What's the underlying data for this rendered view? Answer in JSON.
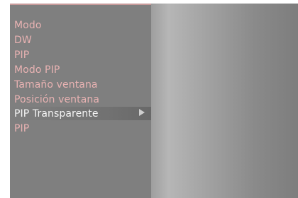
{
  "menu": {
    "items": [
      {
        "label": "Modo"
      },
      {
        "label": "DW"
      },
      {
        "label": "PIP"
      },
      {
        "label": "Modo PIP"
      },
      {
        "label": "Tamaño ventana"
      },
      {
        "label": "Posición ventana"
      },
      {
        "label": "PIP Transparente"
      },
      {
        "label": "PIP"
      }
    ],
    "selected_index": 6
  },
  "icons": {
    "submenu_arrow": "chevron-right-icon"
  }
}
